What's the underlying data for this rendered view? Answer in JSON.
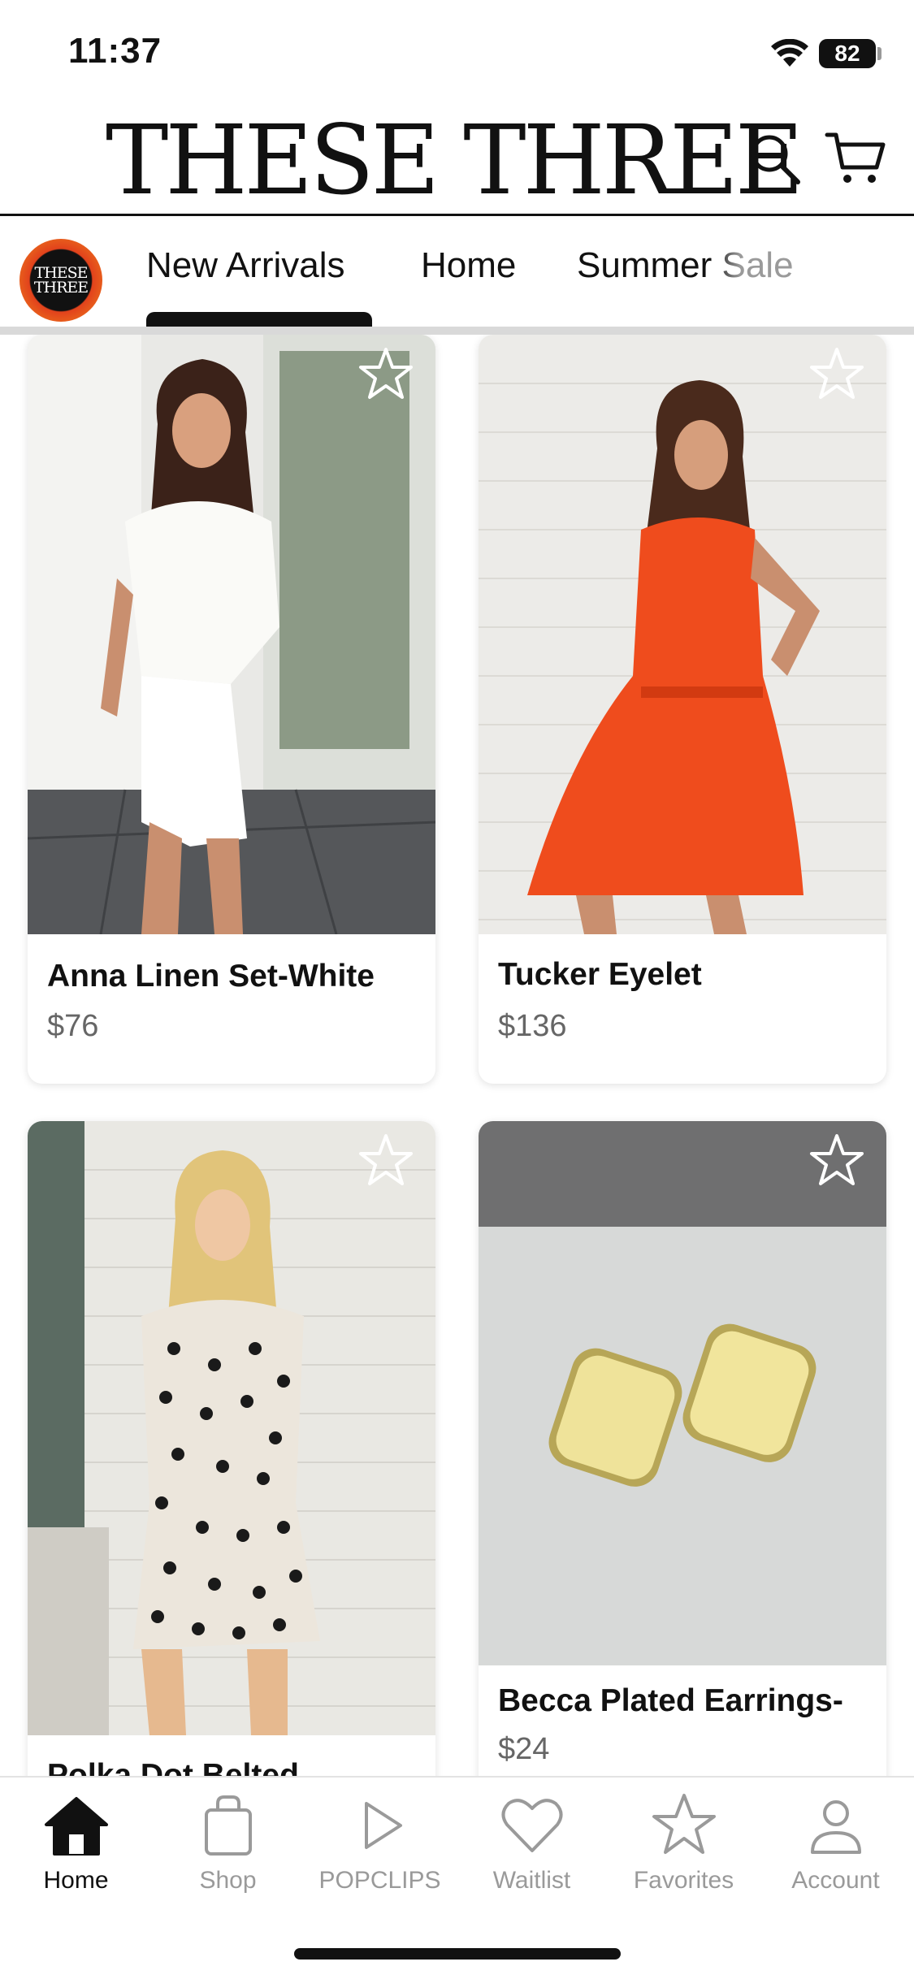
{
  "status_bar": {
    "time": "11:37",
    "battery": "82"
  },
  "header": {
    "brand": "THESE THREE",
    "logo_text": "THESE THREE"
  },
  "tabs": [
    {
      "label": "New Arrivals",
      "active": true
    },
    {
      "label": "Home",
      "active": false
    },
    {
      "label": "Summer Sale",
      "active": false
    }
  ],
  "products": [
    {
      "name": "Anna Linen Set-White",
      "price": "$76"
    },
    {
      "name": "Tucker Eyelet",
      "price": "$136"
    },
    {
      "name": "Polka Dot Belted",
      "price": ""
    },
    {
      "name": "Becca Plated Earrings-",
      "price": "$24"
    }
  ],
  "bottom_nav": [
    {
      "label": "Home",
      "icon": "home-icon",
      "active": true
    },
    {
      "label": "Shop",
      "icon": "shopping-bag-icon",
      "active": false
    },
    {
      "label": "POPCLIPS",
      "icon": "play-icon",
      "active": false
    },
    {
      "label": "Waitlist",
      "icon": "heart-icon",
      "active": false
    },
    {
      "label": "Favorites",
      "icon": "star-icon",
      "active": false
    },
    {
      "label": "Account",
      "icon": "user-icon",
      "active": false
    }
  ],
  "colors": {
    "accent": "#111111",
    "inactive": "#9a9a9a",
    "logo_orange": "#e2421c"
  }
}
